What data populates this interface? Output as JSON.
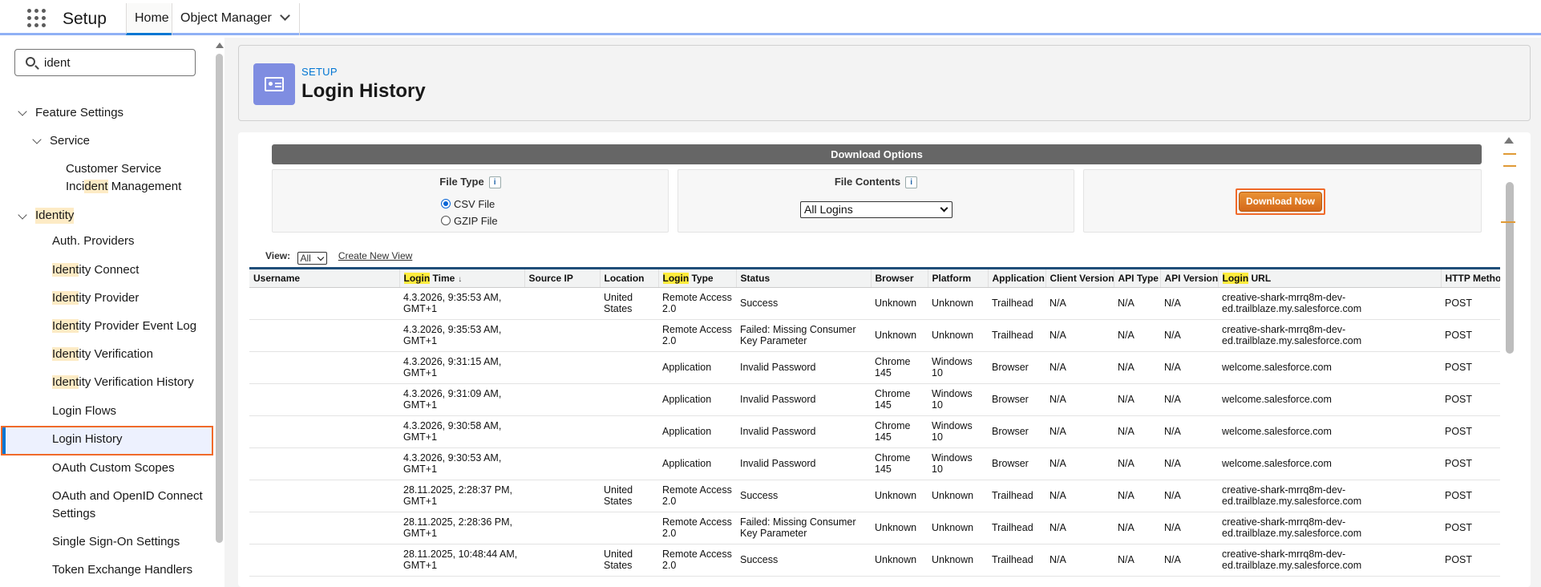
{
  "header": {
    "app_name": "Setup",
    "tabs": [
      {
        "label": "Home"
      },
      {
        "label": "Object Manager"
      }
    ]
  },
  "sidebar": {
    "search_value": "ident",
    "feature_settings": "Feature Settings",
    "service": "Service",
    "customer_service_line1": "Customer Service",
    "customer_service_line2_a": "Inci",
    "customer_service_line2_hl": "dent",
    "customer_service_line2_b": " Management",
    "identity_group": "Identity",
    "items": [
      {
        "hl": "",
        "rest": "Auth. Providers"
      },
      {
        "hl": "Ident",
        "rest": "ity Connect"
      },
      {
        "hl": "Ident",
        "rest": "ity Provider"
      },
      {
        "hl": "Ident",
        "rest": "ity Provider Event Log"
      },
      {
        "hl": "Ident",
        "rest": "ity Verification"
      },
      {
        "hl": "Ident",
        "rest": "ity Verification History"
      },
      {
        "hl": "",
        "rest": "Login Flows"
      },
      {
        "hl": "",
        "rest": "Login History"
      },
      {
        "hl": "",
        "rest": "OAuth Custom Scopes"
      },
      {
        "hl": "",
        "rest": "OAuth and OpenID Connect"
      },
      {
        "hl": "",
        "rest": "Settings"
      },
      {
        "hl": "",
        "rest": "Single Sign-On Settings"
      },
      {
        "hl": "",
        "rest": "Token Exchange Handlers"
      }
    ]
  },
  "page": {
    "eyebrow": "SETUP",
    "title": "Login History"
  },
  "download": {
    "bar_label": "Download Options",
    "file_type_label": "File Type",
    "info_glyph": "i",
    "csv_label": "CSV File",
    "gzip_label": "GZIP File",
    "file_contents_label": "File Contents",
    "contents_selected": "All Logins",
    "button_label": "Download Now"
  },
  "view": {
    "label": "View:",
    "selected": "All",
    "create_link": "Create New View"
  },
  "table": {
    "columns": [
      {
        "pre": "",
        "hl": "",
        "post": "Username"
      },
      {
        "pre": "",
        "hl": "Login",
        "post": " Time"
      },
      {
        "pre": "",
        "hl": "",
        "post": "Source IP"
      },
      {
        "pre": "",
        "hl": "",
        "post": "Location"
      },
      {
        "pre": "",
        "hl": "Login",
        "post": " Type"
      },
      {
        "pre": "",
        "hl": "",
        "post": "Status"
      },
      {
        "pre": "",
        "hl": "",
        "post": "Browser"
      },
      {
        "pre": "",
        "hl": "",
        "post": "Platform"
      },
      {
        "pre": "",
        "hl": "",
        "post": "Application"
      },
      {
        "pre": "",
        "hl": "",
        "post": "Client Version"
      },
      {
        "pre": "",
        "hl": "",
        "post": "API Type"
      },
      {
        "pre": "",
        "hl": "",
        "post": "API Version"
      },
      {
        "pre": "",
        "hl": "Login",
        "post": " URL"
      },
      {
        "pre": "",
        "hl": "",
        "post": "HTTP Method"
      }
    ],
    "sort_glyph": "↓",
    "rows": [
      [
        "",
        "4.3.2026, 9:35:53 AM, GMT+1",
        "",
        "United States",
        "Remote Access 2.0",
        "Success",
        "Unknown",
        "Unknown",
        "Trailhead",
        "N/A",
        "N/A",
        "N/A",
        "creative-shark-mrrq8m-dev-ed.trailblaze.my.salesforce.com",
        "POST"
      ],
      [
        "",
        "4.3.2026, 9:35:53 AM, GMT+1",
        "",
        "",
        "Remote Access 2.0",
        "Failed: Missing Consumer Key Parameter",
        "Unknown",
        "Unknown",
        "Trailhead",
        "N/A",
        "N/A",
        "N/A",
        "creative-shark-mrrq8m-dev-ed.trailblaze.my.salesforce.com",
        "POST"
      ],
      [
        "",
        "4.3.2026, 9:31:15 AM, GMT+1",
        "",
        "",
        "Application",
        "Invalid Password",
        "Chrome 145",
        "Windows 10",
        "Browser",
        "N/A",
        "N/A",
        "N/A",
        "welcome.salesforce.com",
        "POST"
      ],
      [
        "",
        "4.3.2026, 9:31:09 AM, GMT+1",
        "",
        "",
        "Application",
        "Invalid Password",
        "Chrome 145",
        "Windows 10",
        "Browser",
        "N/A",
        "N/A",
        "N/A",
        "welcome.salesforce.com",
        "POST"
      ],
      [
        "",
        "4.3.2026, 9:30:58 AM, GMT+1",
        "",
        "",
        "Application",
        "Invalid Password",
        "Chrome 145",
        "Windows 10",
        "Browser",
        "N/A",
        "N/A",
        "N/A",
        "welcome.salesforce.com",
        "POST"
      ],
      [
        "",
        "4.3.2026, 9:30:53 AM, GMT+1",
        "",
        "",
        "Application",
        "Invalid Password",
        "Chrome 145",
        "Windows 10",
        "Browser",
        "N/A",
        "N/A",
        "N/A",
        "welcome.salesforce.com",
        "POST"
      ],
      [
        "",
        "28.11.2025, 2:28:37 PM, GMT+1",
        "",
        "United States",
        "Remote Access 2.0",
        "Success",
        "Unknown",
        "Unknown",
        "Trailhead",
        "N/A",
        "N/A",
        "N/A",
        "creative-shark-mrrq8m-dev-ed.trailblaze.my.salesforce.com",
        "POST"
      ],
      [
        "",
        "28.11.2025, 2:28:36 PM, GMT+1",
        "",
        "",
        "Remote Access 2.0",
        "Failed: Missing Consumer Key Parameter",
        "Unknown",
        "Unknown",
        "Trailhead",
        "N/A",
        "N/A",
        "N/A",
        "creative-shark-mrrq8m-dev-ed.trailblaze.my.salesforce.com",
        "POST"
      ],
      [
        "",
        "28.11.2025, 10:48:44 AM, GMT+1",
        "",
        "United States",
        "Remote Access 2.0",
        "Success",
        "Unknown",
        "Unknown",
        "Trailhead",
        "N/A",
        "N/A",
        "N/A",
        "creative-shark-mrrq8m-dev-ed.trailblaze.my.salesforce.com",
        "POST"
      ]
    ]
  },
  "colors": {
    "accent": "#0176d3",
    "highlight_orange": "#f06a2a",
    "search_highlight": "#ffec3d",
    "download_button": "#e07b25"
  }
}
